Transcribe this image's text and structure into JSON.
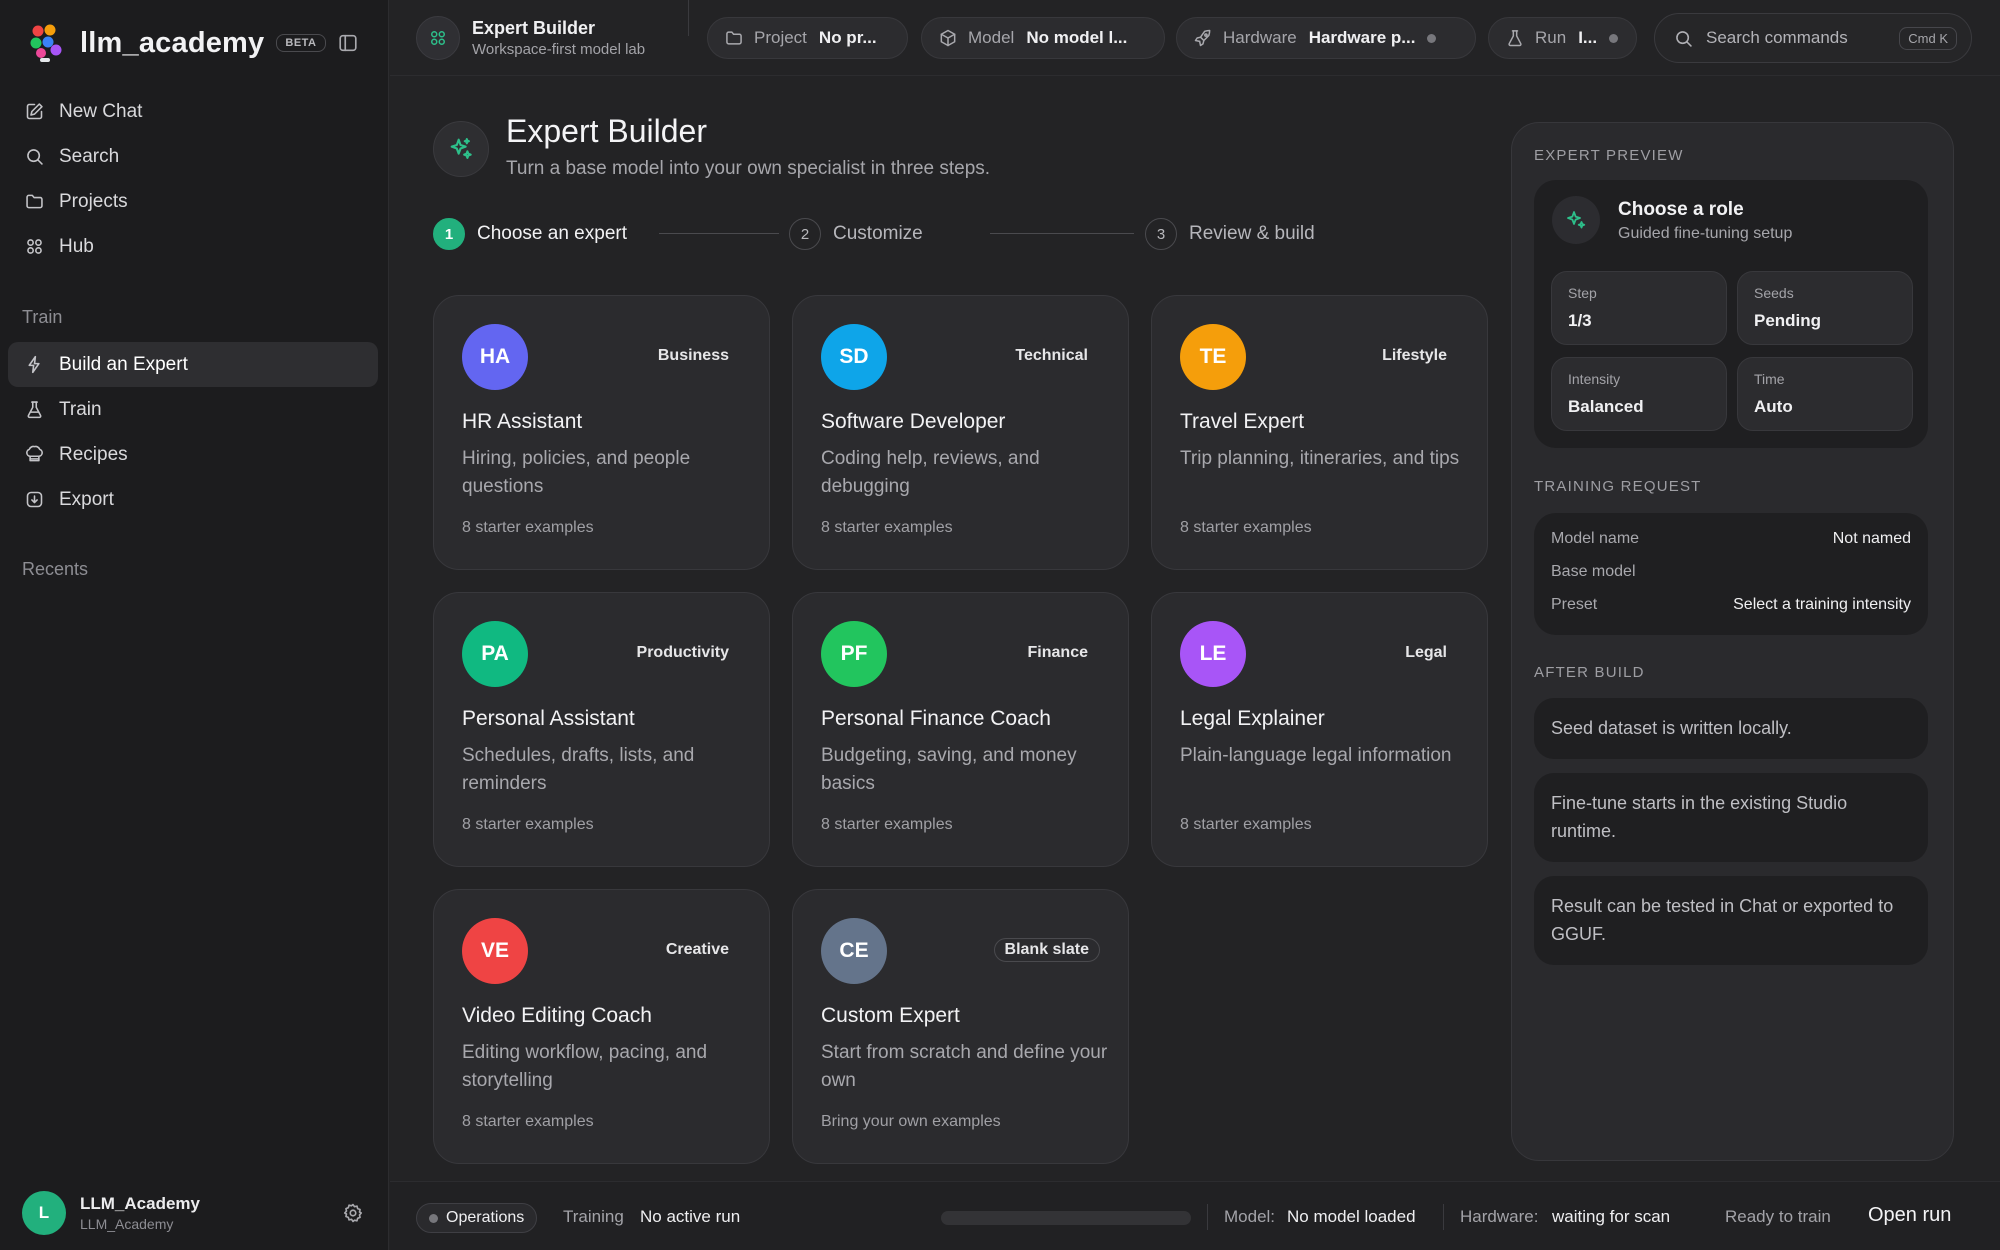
{
  "brand": {
    "name": "llm_academy",
    "badge": "BETA"
  },
  "sidebar": {
    "nav": [
      {
        "label": "New Chat",
        "icon": "edit-icon"
      },
      {
        "label": "Search",
        "icon": "search-icon"
      },
      {
        "label": "Projects",
        "icon": "folder-icon"
      },
      {
        "label": "Hub",
        "icon": "grid-icon"
      }
    ],
    "train_section": "Train",
    "train_items": [
      {
        "label": "Build an Expert",
        "icon": "sparkle-bolt-icon",
        "active": true
      },
      {
        "label": "Train",
        "icon": "flask-icon"
      },
      {
        "label": "Recipes",
        "icon": "chef-hat-icon"
      },
      {
        "label": "Export",
        "icon": "download-icon"
      }
    ],
    "recents_section": "Recents",
    "user": {
      "initial": "L",
      "name": "LLM_Academy",
      "handle": "LLM_Academy"
    }
  },
  "topbar": {
    "app_title": "Expert Builder",
    "app_subtitle": "Workspace-first model lab",
    "project": {
      "label": "Project",
      "value": "No pr..."
    },
    "model": {
      "label": "Model",
      "value": "No model l..."
    },
    "hardware": {
      "label": "Hardware",
      "value": "Hardware p..."
    },
    "run": {
      "label": "Run",
      "value": "I..."
    },
    "search": {
      "placeholder": "Search commands",
      "shortcut": "Cmd K"
    }
  },
  "header": {
    "title": "Expert Builder",
    "subtitle": "Turn a base model into your own specialist in three steps."
  },
  "steps": [
    {
      "num": "1",
      "label": "Choose an expert",
      "active": true
    },
    {
      "num": "2",
      "label": "Customize",
      "active": false
    },
    {
      "num": "3",
      "label": "Review & build",
      "active": false
    }
  ],
  "experts": [
    {
      "initials": "HA",
      "color": "#6366f1",
      "category": "Business",
      "title": "HR Assistant",
      "description": "Hiring, policies, and people questions",
      "meta": "8 starter examples"
    },
    {
      "initials": "SD",
      "color": "#0ea5e9",
      "category": "Technical",
      "title": "Software Developer",
      "description": "Coding help, reviews, and debugging",
      "meta": "8 starter examples"
    },
    {
      "initials": "TE",
      "color": "#f59e0b",
      "category": "Lifestyle",
      "title": "Travel Expert",
      "description": "Trip planning, itineraries, and tips",
      "meta": "8 starter examples"
    },
    {
      "initials": "PA",
      "color": "#10b981",
      "category": "Productivity",
      "title": "Personal Assistant",
      "description": "Schedules, drafts, lists, and reminders",
      "meta": "8 starter examples"
    },
    {
      "initials": "PF",
      "color": "#22c55e",
      "category": "Finance",
      "title": "Personal Finance Coach",
      "description": "Budgeting, saving, and money basics",
      "meta": "8 starter examples"
    },
    {
      "initials": "LE",
      "color": "#a855f7",
      "category": "Legal",
      "title": "Legal Explainer",
      "description": "Plain-language legal information",
      "meta": "8 starter examples"
    },
    {
      "initials": "VE",
      "color": "#ef4444",
      "category": "Creative",
      "title": "Video Editing Coach",
      "description": "Editing workflow, pacing, and storytelling",
      "meta": "8 starter examples"
    },
    {
      "initials": "CE",
      "color": "#64748b",
      "category": "Blank slate",
      "title": "Custom Expert",
      "description": "Start from scratch and define your own",
      "meta": "Bring your own examples"
    }
  ],
  "preview": {
    "heading": "EXPERT PREVIEW",
    "title": "Choose a role",
    "subtitle": "Guided fine-tuning setup",
    "stats": [
      {
        "label": "Step",
        "value": "1/3"
      },
      {
        "label": "Seeds",
        "value": "Pending"
      },
      {
        "label": "Intensity",
        "value": "Balanced"
      },
      {
        "label": "Time",
        "value": "Auto"
      }
    ]
  },
  "training_request": {
    "heading": "TRAINING REQUEST",
    "rows": [
      {
        "key": "Model name",
        "value": "Not named"
      },
      {
        "key": "Base model",
        "value": ""
      },
      {
        "key": "Preset",
        "value": "Select a training intensity"
      }
    ]
  },
  "after_build": {
    "heading": "AFTER BUILD",
    "items": [
      "Seed dataset is written locally.",
      "Fine-tune starts in the existing Studio runtime.",
      "Result can be tested in Chat or exported to GGUF."
    ]
  },
  "bottombar": {
    "operations": "Operations",
    "training_label": "Training",
    "training_value": "No active run",
    "progress": 0,
    "model_label": "Model:",
    "model_value": "No model loaded",
    "hardware_label": "Hardware:",
    "hardware_value": "waiting for scan",
    "status": "Ready to train",
    "open_run": "Open run"
  },
  "colors": {
    "accent": "#22b07d",
    "background": "#232325",
    "sidebar": "#1c1c1e"
  }
}
